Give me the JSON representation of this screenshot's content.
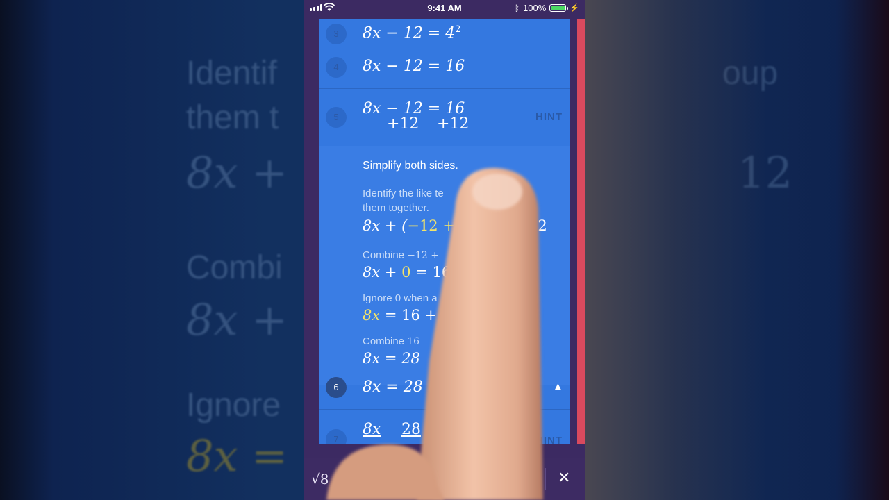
{
  "status": {
    "time": "9:41 AM",
    "battery": "100%"
  },
  "bg": {
    "row1": "Identif",
    "row1b": "oup",
    "row2": "them t",
    "row3": "8x +",
    "row3b": "12",
    "row4": "Combi",
    "row5": "8x +",
    "row6": "Ignore",
    "row7": "8x ="
  },
  "steps": [
    {
      "num": "3",
      "lhs": "8x − 12 = 4",
      "sup": "2"
    },
    {
      "num": "4",
      "lhs": "8x − 12 = 16"
    },
    {
      "num": "5",
      "line1": "8x − 12 = 16",
      "line2": "+12",
      "line3": "+12",
      "hint": "HINT"
    },
    {
      "num": "6",
      "lhs": "8x = 28"
    },
    {
      "num": "7",
      "left": "8x",
      "right": "28",
      "hint": "HINT"
    }
  ],
  "detail": {
    "title": "Simplify both sides.",
    "text1": "Identify the like te",
    "text1b": "oup",
    "text1c": "them together.",
    "math1a": "8x + (",
    "math1b": "−12 + 1",
    "math1c": "12",
    "text2": "Combine",
    "text2m": "−12 +",
    "math2a": "8x + ",
    "math2b": "0",
    "math2c": " = 16 +",
    "text3": "Ignore 0 when a",
    "math3a": "8x",
    "math3b": " = 16 + 12",
    "text4": "Combine",
    "text4m": "16",
    "math4": "8x = 28"
  },
  "bottom": {
    "sqrt": "√8",
    "close": "✕"
  }
}
